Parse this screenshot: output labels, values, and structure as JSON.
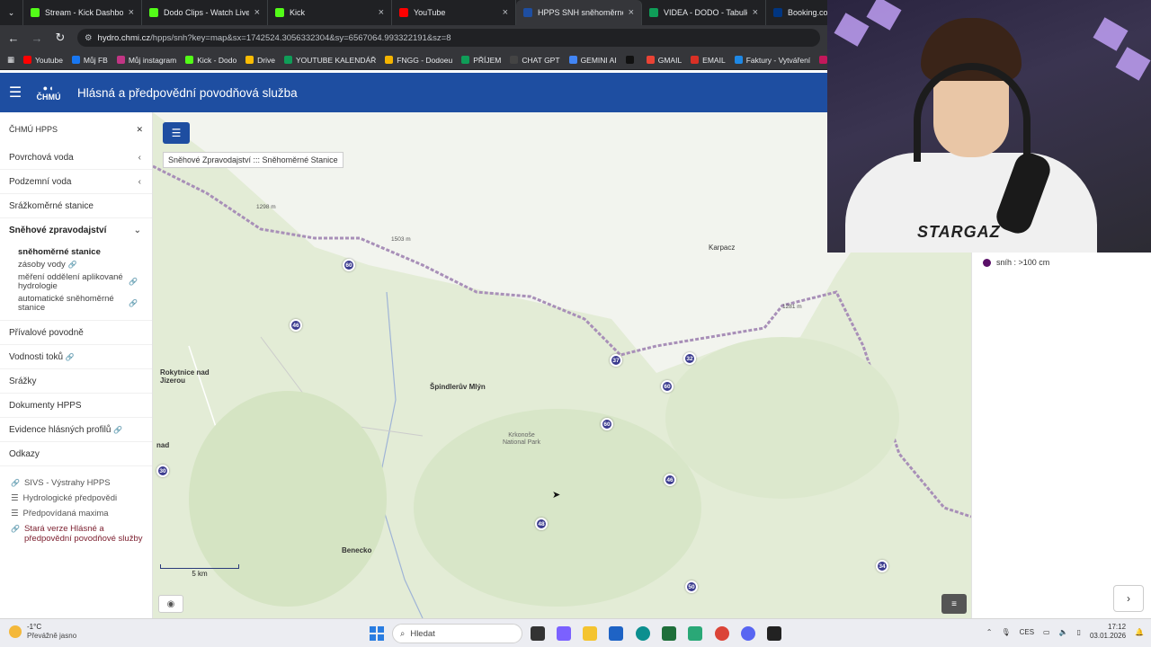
{
  "browser": {
    "tabs": [
      {
        "title": "Stream - Kick Dashboard",
        "color": "#53fc18"
      },
      {
        "title": "Dodo Clips - Watch Live o",
        "color": "#53fc18"
      },
      {
        "title": "Kick",
        "color": "#53fc18"
      },
      {
        "title": "YouTube",
        "color": "#ff0000"
      },
      {
        "title": "HPPS SNH sněhoměrné st",
        "color": "#1e4ea1",
        "active": true
      },
      {
        "title": "VIDEA - DODO - Tabulky",
        "color": "#0f9d58"
      },
      {
        "title": "Booking.com",
        "color": "#003580"
      }
    ],
    "url_host": "hydro.chmi.cz",
    "url_path": "/hpps/snh?key=map&sx=1742524.3056332304&sy=6567064.993322191&sz=8",
    "bookmarks": [
      {
        "label": "Youtube",
        "color": "#ff0000"
      },
      {
        "label": "Můj FB",
        "color": "#1877f2"
      },
      {
        "label": "Můj instagram",
        "color": "#c13584"
      },
      {
        "label": "Kick - Dodo",
        "color": "#53fc18"
      },
      {
        "label": "Drive",
        "color": "#fbbc04"
      },
      {
        "label": "YOUTUBE KALENDÁŘ",
        "color": "#0f9d58"
      },
      {
        "label": "FNGG - Dodoeu",
        "color": "#f4b400"
      },
      {
        "label": "PŘÍJEM",
        "color": "#0f9d58"
      },
      {
        "label": "CHAT GPT",
        "color": "#444444"
      },
      {
        "label": "GEMINI AI",
        "color": "#4285f4"
      },
      {
        "label": "",
        "color": "#111111"
      },
      {
        "label": "GMAIL",
        "color": "#ea4335"
      },
      {
        "label": "EMAIL",
        "color": "#d93025"
      },
      {
        "label": "Faktury - Vytváření",
        "color": "#1e88e5"
      },
      {
        "label": "P",
        "color": "#c2185b"
      }
    ]
  },
  "header": {
    "logo_text": "ČHMÚ",
    "title": "Hlásná a předpovědní povodňová služba"
  },
  "sidebar": {
    "top_label": "ČHMÚ HPPS",
    "items": [
      {
        "label": "Povrchová voda"
      },
      {
        "label": "Podzemní voda"
      },
      {
        "label": "Srážkoměrné stanice"
      },
      {
        "label": "Sněhové zpravodajství"
      }
    ],
    "snow_subitems": [
      {
        "label": "sněhoměrné stanice"
      },
      {
        "label": "zásoby vody"
      },
      {
        "label": "měření oddělení aplikované hydrologie"
      },
      {
        "label": "automatické sněhoměrné stanice"
      }
    ],
    "items2": [
      {
        "label": "Přívalové povodně"
      },
      {
        "label": "Vodnosti toků"
      },
      {
        "label": "Srážky"
      },
      {
        "label": "Dokumenty HPPS"
      },
      {
        "label": "Evidence hlásných profilů"
      },
      {
        "label": "Odkazy"
      }
    ],
    "links": [
      {
        "label": "SIVS - Výstrahy HPPS"
      },
      {
        "label": "Hydrologické předpovědi"
      },
      {
        "label": "Předpovídaná maxima"
      },
      {
        "label": "Stará verze Hlásné a předpovědní povodňové služby"
      }
    ]
  },
  "map": {
    "tooltip": "Sněhové Zpravodajství ::: Sněhoměrné Stanice",
    "labels": {
      "karpacz": "Karpacz",
      "spindleruv": "Špindlerův Mlýn",
      "rokytnice": "Rokytnice nad Jizerou",
      "nad": "nad",
      "benecko": "Benecko",
      "park": "Krkonoše National Park",
      "elev1": "1298 m",
      "elev2": "1503 m",
      "elev3": "1281 m"
    },
    "markers": [
      "60",
      "46",
      "37",
      "32",
      "60",
      "60",
      "46",
      "30",
      "48",
      "34",
      "50"
    ],
    "scale": "5 km"
  },
  "legend": {
    "label": "sníh : >100 cm",
    "color": "#5a1068"
  },
  "taskbar": {
    "temp": "-1°C",
    "weather": "Převážně jasno",
    "search": "Hledat",
    "lang": "CES",
    "time": "17:12",
    "date": "03.01.2026"
  },
  "webcam": {
    "shirt_text": "STARGAZ"
  }
}
